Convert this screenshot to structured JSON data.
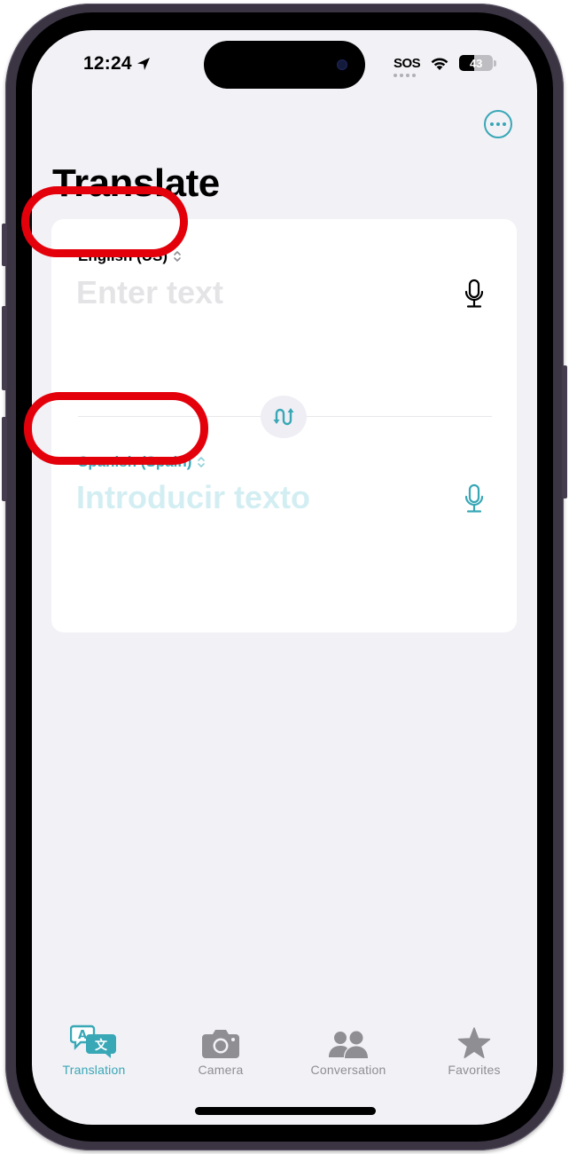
{
  "status_bar": {
    "time": "12:24",
    "location_icon": "location-arrow-icon",
    "carrier": "SOS",
    "wifi_icon": "wifi-icon",
    "battery_level": "43",
    "battery_percent": 43
  },
  "header": {
    "title": "Translate",
    "more_icon": "ellipsis-circle-icon"
  },
  "translation_card": {
    "source": {
      "language": "English (US)",
      "placeholder": "Enter text",
      "value": "",
      "mic_icon": "microphone-icon"
    },
    "target": {
      "language": "Spanish (Spain)",
      "placeholder": "Introducir texto",
      "value": "",
      "mic_icon": "microphone-icon"
    },
    "swap_icon": "swap-languages-icon"
  },
  "tab_bar": {
    "items": [
      {
        "label": "Translation",
        "icon": "translate-bubbles-icon",
        "active": true
      },
      {
        "label": "Camera",
        "icon": "camera-icon",
        "active": false
      },
      {
        "label": "Conversation",
        "icon": "people-icon",
        "active": false
      },
      {
        "label": "Favorites",
        "icon": "star-icon",
        "active": false
      }
    ]
  },
  "colors": {
    "accent": "#38a7b6",
    "inactive": "#8e8e93",
    "background": "#f2f1f6",
    "annotation": "#e3000b"
  }
}
